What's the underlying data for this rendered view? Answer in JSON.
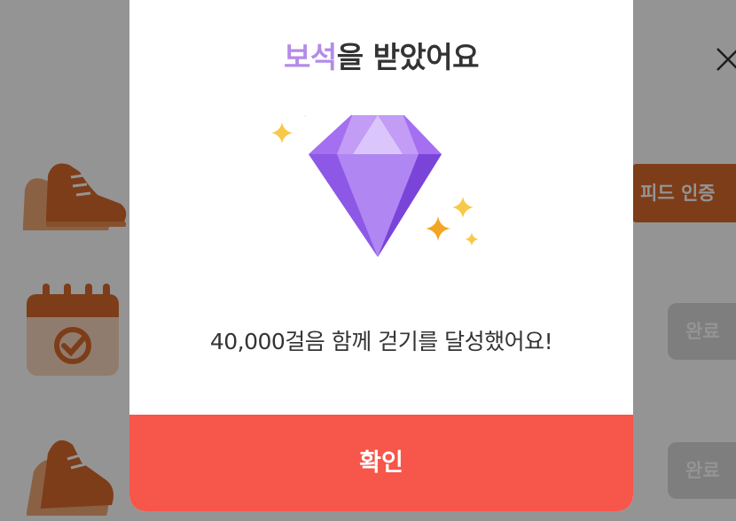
{
  "background": {
    "feed_button_label": "피드 인증",
    "done_button_label": "완료",
    "rows": [
      {
        "icon": "sneakers-icon"
      },
      {
        "icon": "calendar-check-icon"
      },
      {
        "icon": "sneaker-icon"
      }
    ],
    "close_icon": "close-icon"
  },
  "modal": {
    "title_highlight": "보석",
    "title_rest": "을 받았어요",
    "illustration": "diamond-sparkle-icon",
    "message": "40,000걸음 함께 걷기를 달성했어요!",
    "confirm_label": "확인"
  },
  "colors": {
    "accent_purple": "#b48be8",
    "confirm_red": "#f7564a",
    "feed_orange": "#d86a2c",
    "done_gray": "#d9d9d9"
  }
}
